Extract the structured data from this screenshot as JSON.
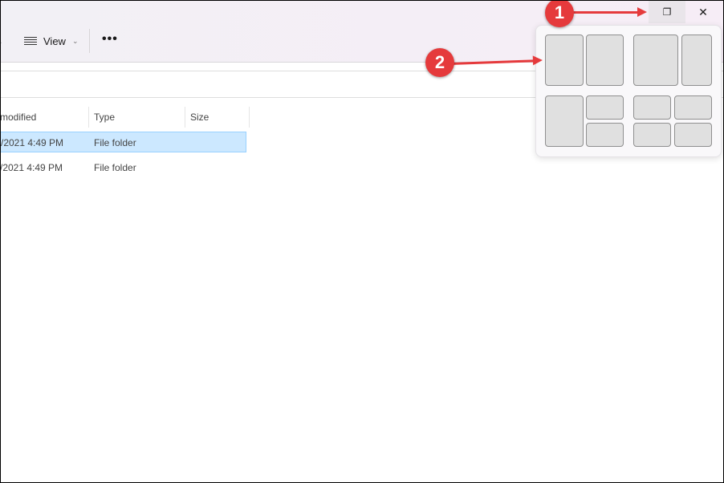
{
  "toolbar": {
    "view_label": "View",
    "more_label": "•••",
    "view_icon": "view-lines-icon"
  },
  "columns": [
    "modified",
    "Type",
    "Size"
  ],
  "rows": [
    {
      "date": "/2021 4:49 PM",
      "type": "File folder",
      "selected": true
    },
    {
      "date": "/2021 4:49 PM",
      "type": "File folder",
      "selected": false
    }
  ],
  "window_buttons": {
    "restore": "❐",
    "close": "✕"
  },
  "annotations": [
    "1",
    "2"
  ],
  "snap_layouts": [
    "two-equal",
    "wide-narrow",
    "left-plus-two",
    "four-grid"
  ],
  "colors": {
    "accent": "#e53a3c",
    "selection": "#cce8ff"
  }
}
